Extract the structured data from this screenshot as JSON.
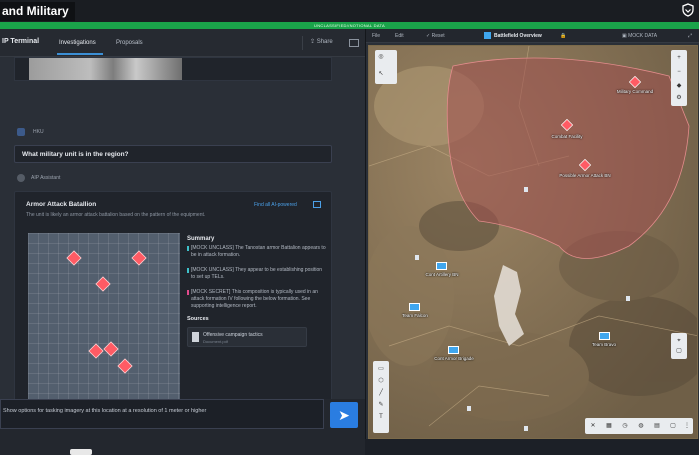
{
  "header": {
    "app_title": "and Military",
    "classification_banner": "UNCLASSIFIED//NOTIONAL DATA"
  },
  "left_panel": {
    "title": "IP Terminal",
    "tabs": [
      {
        "label": "Investigations",
        "active": true
      },
      {
        "label": "Proposals",
        "active": false
      }
    ],
    "share_label": "Share"
  },
  "chat": {
    "user_name": "HKU",
    "user_question": "What military unit is in the region?",
    "assistant_name": "AIP Assistant",
    "answer": {
      "title": "Armor Attack Batallion",
      "subtitle": "The unit is likely an armor attack battalion based on the pattern of the equipment.",
      "link_label": "Find all AI-powered",
      "summary_title": "Summary",
      "summary_items": [
        {
          "text": "[MOCK UNCLASS] The Tanostan armor Battalion appears to be in attack formation.",
          "color": "#3ec1c9"
        },
        {
          "text": "[MOCK UNCLASS] They appear to be establishing position to set up TELs.",
          "color": "#3ec1c9"
        },
        {
          "text": "[MOCK SECRET] This composition is typically used in an attack formation IV following the below formation. See supporting intelligence report.",
          "color": "#e24a8d"
        }
      ],
      "sources_title": "Sources",
      "source": {
        "title": "Offensive campaign tactics",
        "meta": "Document.pdf"
      }
    },
    "input_text": "Show options for tasking imagery at this location at a resolution of 1 meter or higher"
  },
  "map_panel": {
    "toolbar": {
      "file": "File",
      "edit": "Edit",
      "reset": "Reset",
      "title": "Battlefield Overview",
      "data_mode": "MOCK DATA"
    },
    "labels": {
      "hostile": [
        {
          "name": "Military Command"
        },
        {
          "name": "Combat Facility"
        },
        {
          "name": "Possible Armor Attack BN"
        }
      ],
      "friendly": [
        {
          "name": "Cont Artillery BN"
        },
        {
          "name": "Team Falcon"
        },
        {
          "name": "Cont Armor Brigade"
        },
        {
          "name": "Team Bravo"
        }
      ]
    }
  },
  "colors": {
    "accent": "#2a7de1",
    "classification": "#1aa34a",
    "hostile": "#e2555b",
    "friendly": "#3fa6ee"
  }
}
